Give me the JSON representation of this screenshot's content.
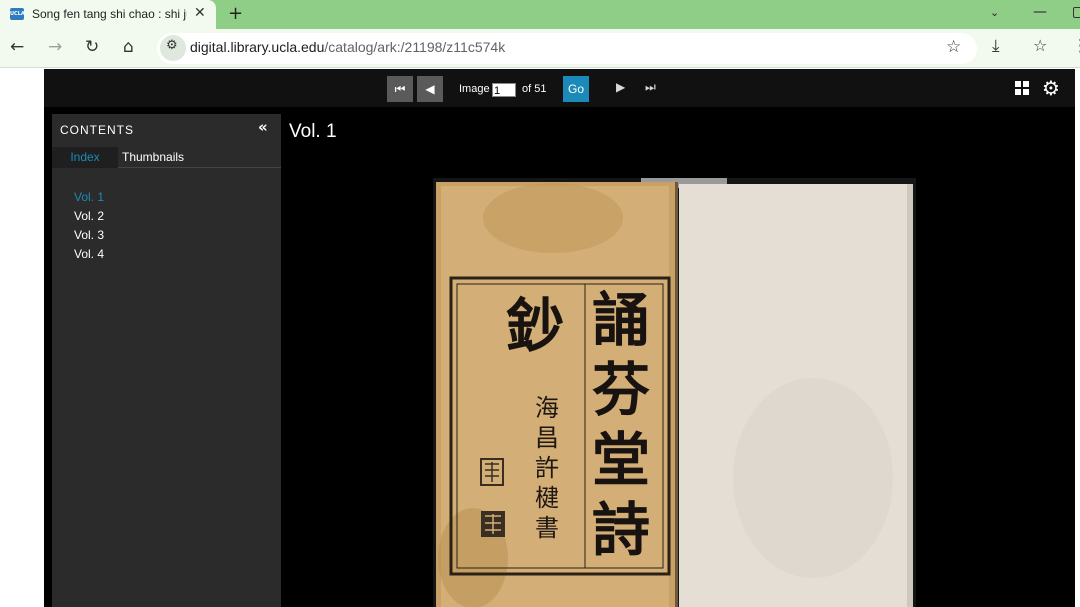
{
  "browser": {
    "tab_title": "Song fen tang shi chao : shi ju",
    "favicon_text": "UCLA",
    "url_host": "digital.library.ucla.edu",
    "url_path": "/catalog/ark:/21198/z11c574k"
  },
  "viewer": {
    "image_label": "Image",
    "image_value": "1",
    "of_label": "of 51",
    "go_label": "Go"
  },
  "contents": {
    "title": "CONTENTS",
    "tabs": [
      "Index",
      "Thumbnails"
    ],
    "volumes": [
      {
        "label": "Vol. 1",
        "active": true
      },
      {
        "label": "Vol. 2",
        "active": false
      },
      {
        "label": "Vol. 3",
        "active": false
      },
      {
        "label": "Vol. 4",
        "active": false
      }
    ]
  },
  "page": {
    "heading": "Vol. 1"
  },
  "scan": {
    "large_title": [
      "誦",
      "芬",
      "堂",
      "詩"
    ],
    "side_char": "鈔",
    "author": [
      "海",
      "昌",
      "許",
      "楗",
      "書"
    ]
  },
  "colors": {
    "tab_strip": "#8fce86",
    "accent": "#1b8ab8",
    "viewer_bg": "#000000",
    "panel_bg": "#2b2b2b"
  }
}
